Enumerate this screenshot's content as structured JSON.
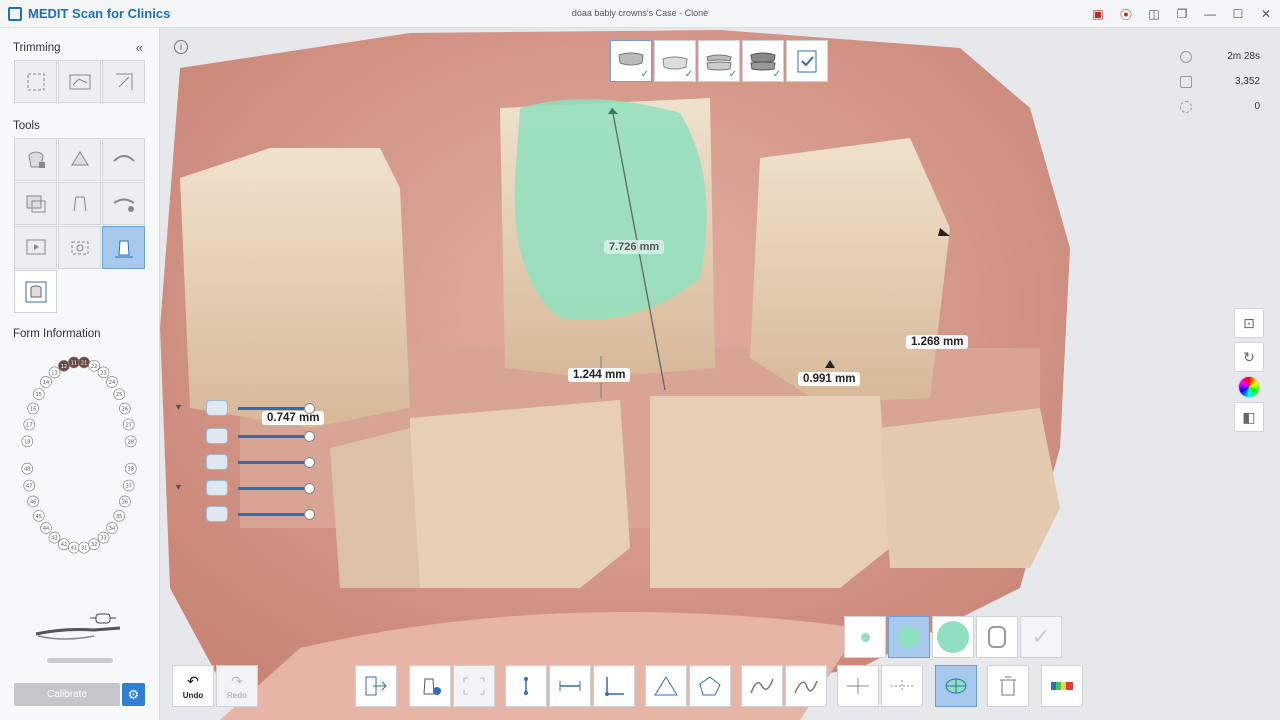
{
  "app": {
    "name": "MEDIT Scan for Clinics",
    "window_title": "doaa bably crowns's Case - Clone"
  },
  "left_panel": {
    "trimming_title": "Trimming",
    "tools_title": "Tools",
    "form_info_title": "Form Information",
    "calibrate_label": "Calibrate",
    "upper_teeth": [
      "18",
      "17",
      "16",
      "15",
      "14",
      "13",
      "12",
      "11",
      "21",
      "22",
      "23",
      "24",
      "25",
      "26",
      "27",
      "28"
    ],
    "lower_teeth": [
      "48",
      "47",
      "46",
      "45",
      "44",
      "43",
      "42",
      "41",
      "31",
      "32",
      "33",
      "34",
      "35",
      "36",
      "37",
      "38"
    ]
  },
  "stats": {
    "time": "2m 28s",
    "count": "3,352",
    "third": "0"
  },
  "measurements": {
    "height": "7.726 mm",
    "gap_center": "1.244 mm",
    "gap_right": "0.991 mm",
    "right_tooth": "1.268 mm",
    "left_tooth": "0.747 mm"
  },
  "bottom": {
    "undo_label": "Undo",
    "redo_label": "Redo"
  },
  "colors": {
    "accent": "#2f7fd4",
    "highlight": "#8fe0c0",
    "active_bg": "#a7c9ee"
  }
}
